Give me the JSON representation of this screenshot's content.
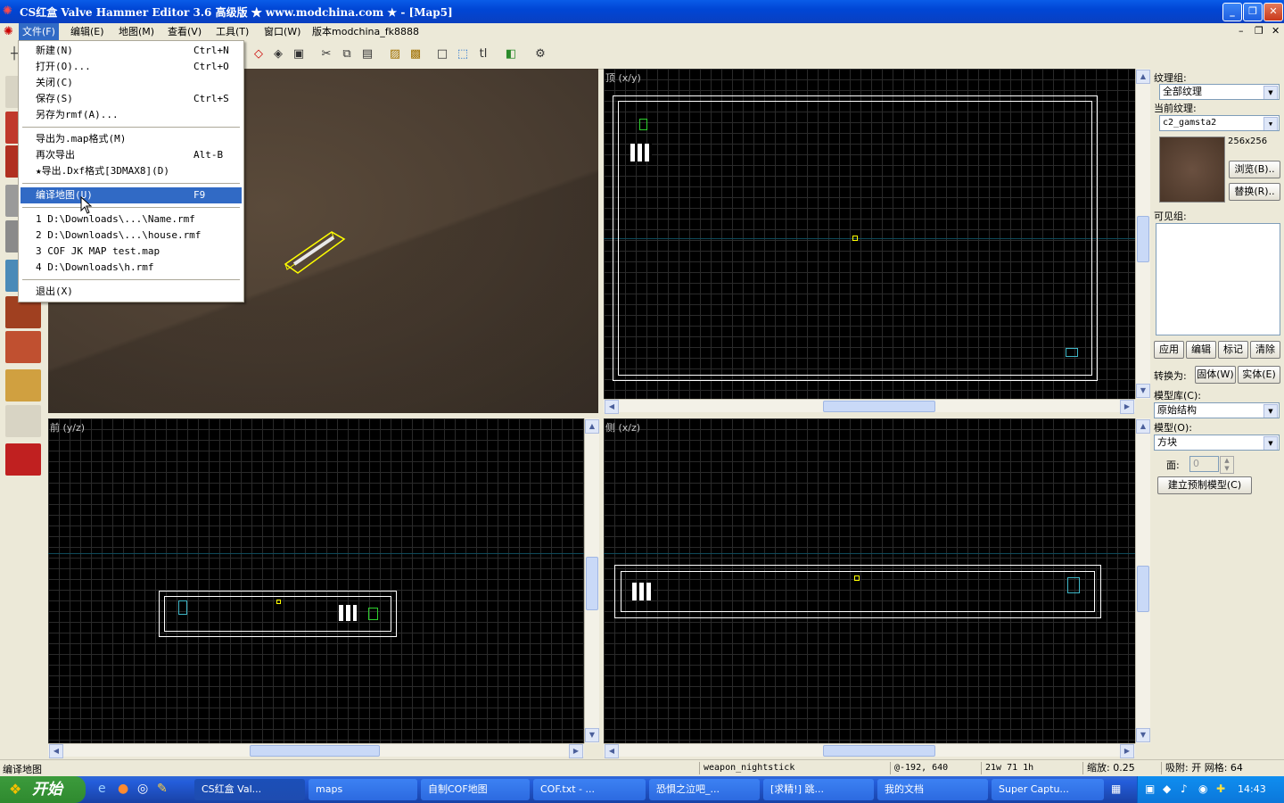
{
  "window": {
    "title": "CS红盒 Valve Hammer Editor 3.6 高级版 ★ www.modchina.com ★ - [Map5]",
    "controls": {
      "minimize": "_",
      "restore": "❐",
      "close": "✕"
    }
  },
  "menubar": {
    "items": [
      "文件(F)",
      "编辑(E)",
      "地图(M)",
      "查看(V)",
      "工具(T)",
      "窗口(W)",
      "版本modchina_fk8888"
    ]
  },
  "file_menu": {
    "group1": [
      {
        "label": "新建(N)",
        "shortcut": "Ctrl+N"
      },
      {
        "label": "打开(O)...",
        "shortcut": "Ctrl+O"
      },
      {
        "label": "关闭(C)",
        "shortcut": ""
      },
      {
        "label": "保存(S)",
        "shortcut": "Ctrl+S"
      },
      {
        "label": "另存为rmf(A)...",
        "shortcut": ""
      }
    ],
    "group2": [
      {
        "label": "导出为.map格式(M)",
        "shortcut": ""
      },
      {
        "label": "再次导出",
        "shortcut": "Alt-B"
      },
      {
        "label": "★导出.Dxf格式[3DMAX8](D)",
        "shortcut": ""
      }
    ],
    "compile": {
      "label": "编译地图(U)",
      "shortcut": "F9"
    },
    "recent": [
      "1 D:\\Downloads\\...\\Name.rmf",
      "2 D:\\Downloads\\...\\house.rmf",
      "3 COF JK MAP test.map",
      "4 D:\\Downloads\\h.rmf"
    ],
    "exit": "退出(X)"
  },
  "viewports": {
    "top": "顶 (x/y)",
    "front": "前 (y/z)",
    "side": "侧 (x/z)"
  },
  "right_panel": {
    "texture_group_label": "纹理组:",
    "texture_group_value": "全部纹理",
    "current_texture_label": "当前纹理:",
    "current_texture_value": "c2_gamsta2",
    "texture_size": "256x256",
    "browse": "浏览(B)..",
    "replace": "替换(R)..",
    "visgroups_label": "可见组:",
    "vis_buttons": [
      "应用",
      "编辑",
      "标记",
      "清除"
    ],
    "convert_label": "转换为:",
    "to_solid": "固体(W)",
    "to_entity": "实体(E)",
    "prefab_lib_label": "模型库(C):",
    "prefab_lib_value": "原始结构",
    "prefab_label": "模型(O):",
    "prefab_value": "方块",
    "faces_label": "面:",
    "faces_value": "0",
    "create_prefab": "建立预制模型(C)"
  },
  "statusbar": {
    "message": "编译地图",
    "entity": "weapon_nightstick",
    "coords": "@-192, 640",
    "size": "21w 71 1h",
    "zoom": "缩放: 0.25",
    "snap": "吸附: 开 网格: 64"
  },
  "taskbar": {
    "start": "开始",
    "tasks": [
      "CS红盒 Val...",
      "maps",
      "自制COF地图",
      "COF.txt - ...",
      "恐惧之泣吧_...",
      "[求精!] 跳...",
      "我的文档",
      "Super Captu..."
    ],
    "clock": "14:43"
  },
  "colors": {
    "selection": "#316ac5",
    "titlebar": "#0046d5",
    "grid_bg": "#000000",
    "brush_outline": "#ffffff",
    "selected_brush": "#ffff00"
  }
}
